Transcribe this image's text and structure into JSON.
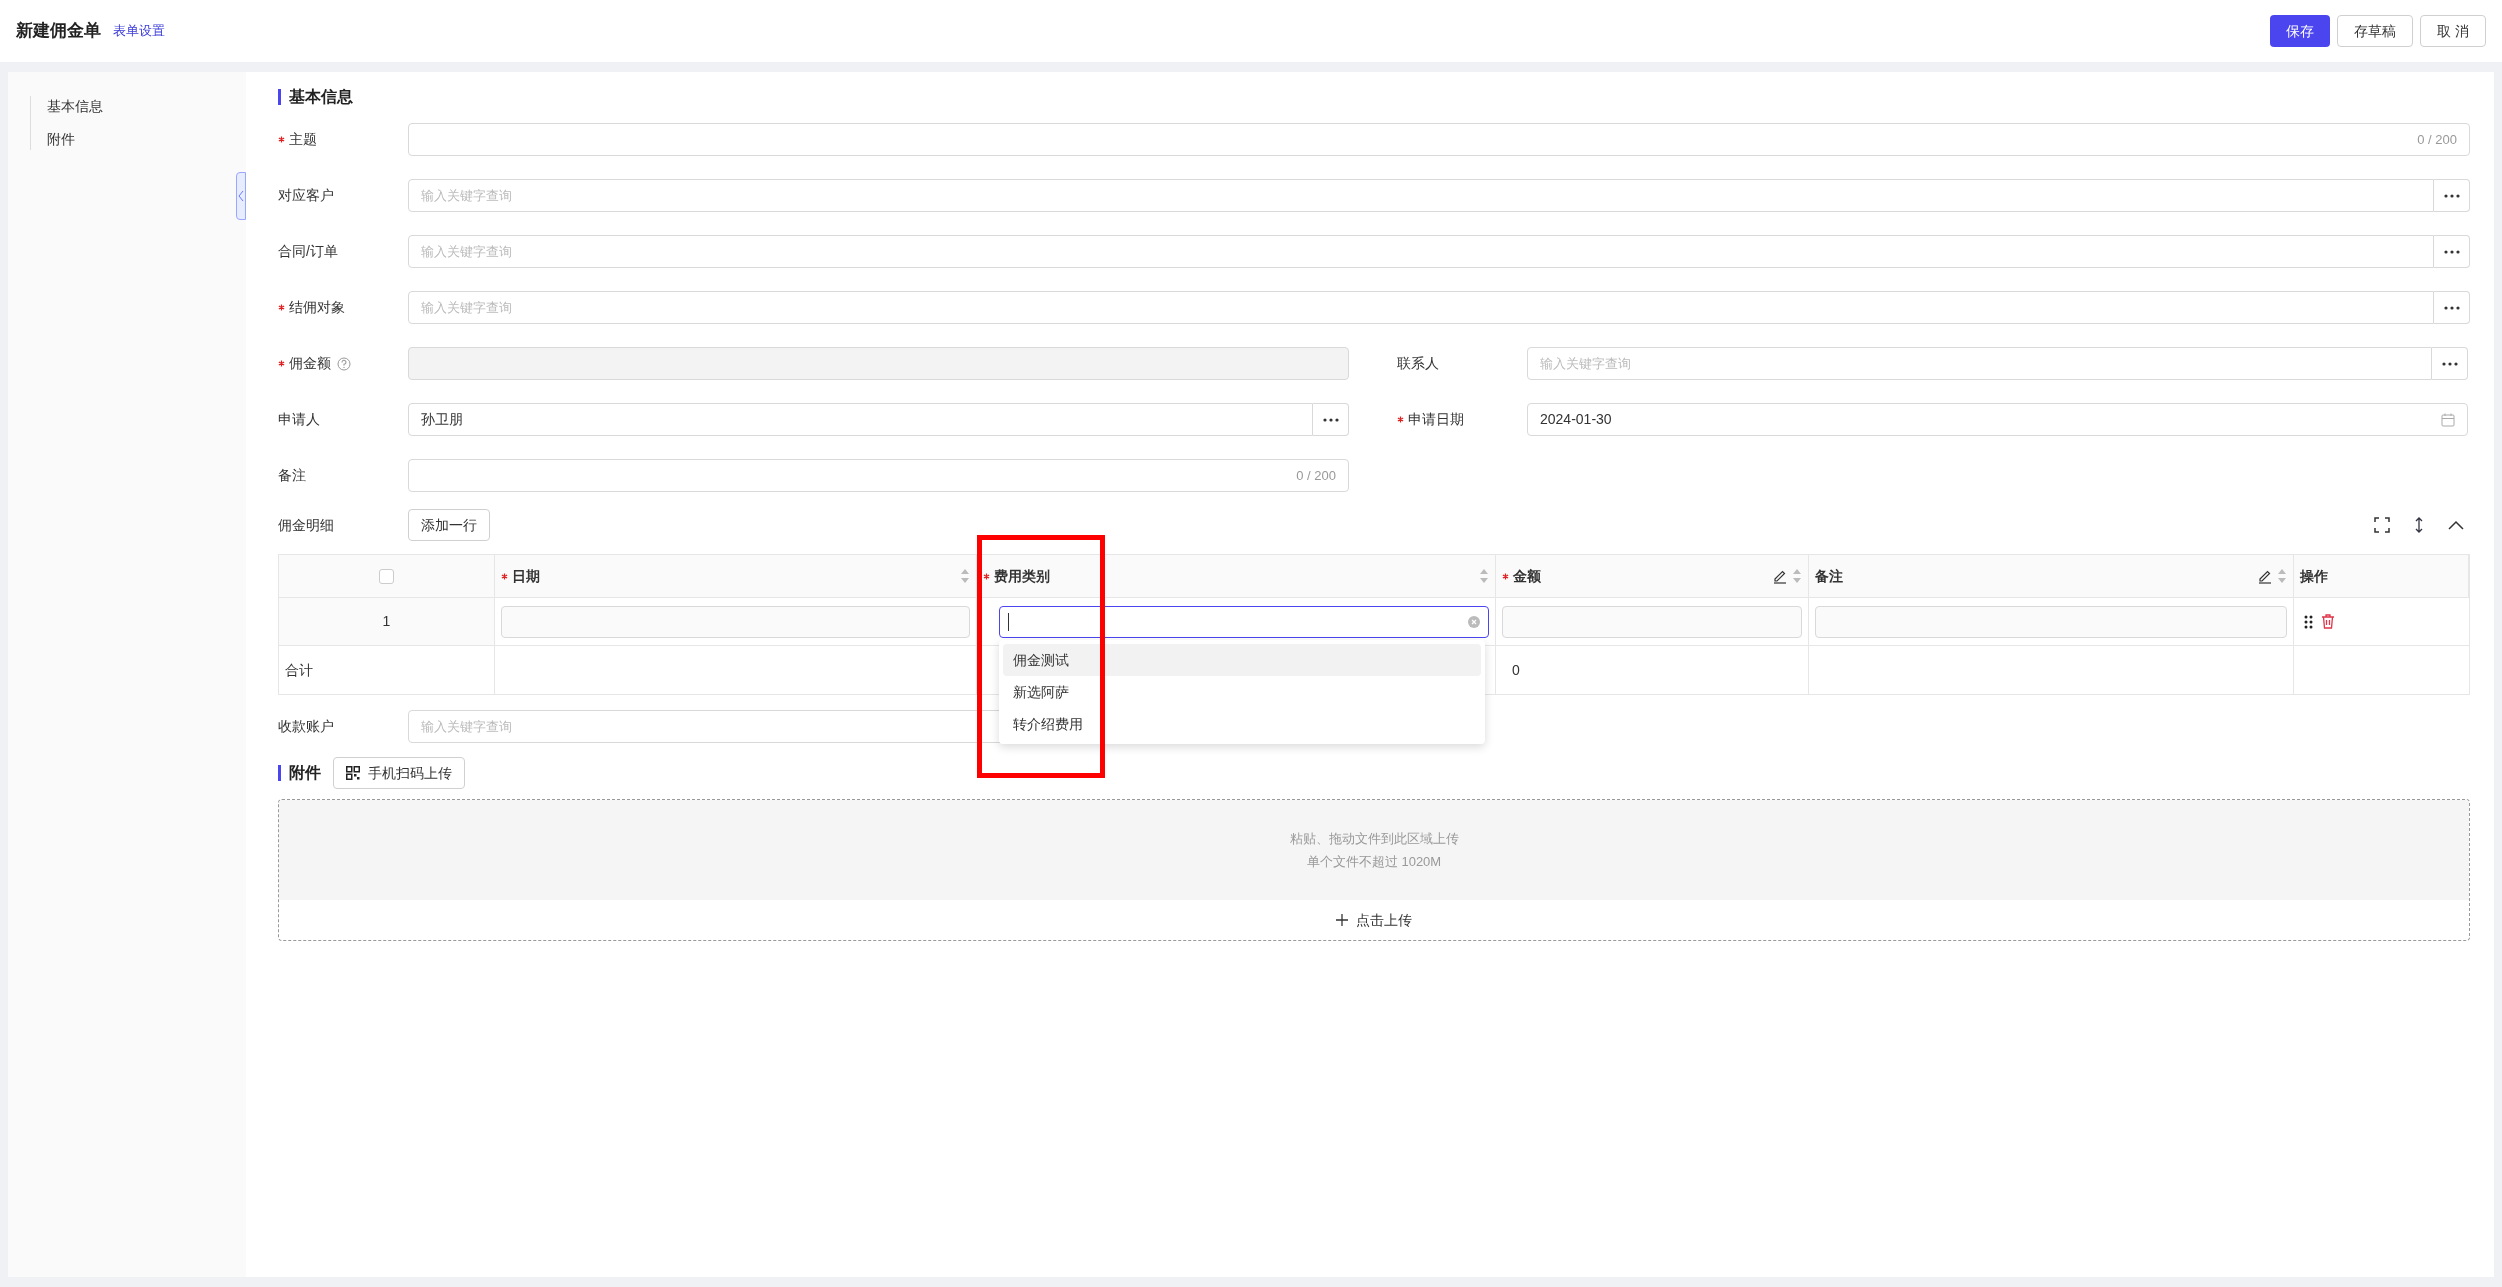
{
  "header": {
    "title": "新建佣金单",
    "link": "表单设置",
    "buttons": [
      {
        "label": "保存",
        "kind": "primary"
      },
      {
        "label": "存草稿",
        "kind": "default"
      },
      {
        "label": "取 消",
        "kind": "default"
      }
    ]
  },
  "sidebar": {
    "items": [
      {
        "label": "基本信息"
      },
      {
        "label": "附件"
      }
    ]
  },
  "basic": {
    "title": "基本信息",
    "rows": [
      {
        "kind": "wide",
        "fields": [
          {
            "label": "主题",
            "required": true,
            "kind": "text",
            "counter": "0 / 200"
          }
        ]
      },
      {
        "kind": "wide",
        "fields": [
          {
            "label": "对应客户",
            "required": false,
            "kind": "lookup",
            "placeholder": "输入关键字查询"
          }
        ]
      },
      {
        "kind": "wide",
        "fields": [
          {
            "label": "合同/订单",
            "required": false,
            "kind": "lookup",
            "placeholder": "输入关键字查询"
          }
        ]
      },
      {
        "kind": "wide",
        "fields": [
          {
            "label": "结佣对象",
            "required": true,
            "kind": "lookup",
            "placeholder": "输入关键字查询"
          }
        ]
      },
      {
        "kind": "split",
        "fields": [
          {
            "label": "佣金额",
            "required": true,
            "kind": "readonly",
            "help": true
          },
          {
            "label": "联系人",
            "required": false,
            "kind": "lookup",
            "placeholder": "输入关键字查询"
          }
        ]
      },
      {
        "kind": "split",
        "fields": [
          {
            "label": "申请人",
            "required": false,
            "kind": "lookup",
            "value": "孙卫朋"
          },
          {
            "label": "申请日期",
            "required": true,
            "kind": "date",
            "value": "2024-01-30"
          }
        ]
      },
      {
        "kind": "split",
        "fields": [
          {
            "label": "备注",
            "required": false,
            "kind": "text",
            "counter": "0 / 200"
          }
        ]
      }
    ]
  },
  "detail": {
    "label": "佣金明细",
    "add_button": "添加一行",
    "header_checkbox": {
      "checked": false
    },
    "columns": [
      {
        "label": "日期",
        "required": true,
        "sortable": true,
        "editable": false
      },
      {
        "label": "费用类别",
        "required": true,
        "sortable": true,
        "editable": false
      },
      {
        "label": "金额",
        "required": true,
        "sortable": true,
        "editable": true
      },
      {
        "label": "备注",
        "required": false,
        "sortable": true,
        "editable": true
      },
      {
        "label": "操作",
        "required": false,
        "sortable": false,
        "editable": false
      }
    ],
    "rows": [
      {
        "index": "1",
        "cells": [
          {
            "kind": "input"
          },
          {
            "kind": "select"
          },
          {
            "kind": "input"
          },
          {
            "kind": "input"
          }
        ]
      }
    ],
    "total": {
      "label": "合计",
      "amount": "0"
    },
    "dropdown": {
      "open": true,
      "options": [
        {
          "label": "佣金测试",
          "selected": true
        },
        {
          "label": "新选阿萨",
          "selected": false
        },
        {
          "label": "转介绍费用",
          "selected": false
        }
      ]
    }
  },
  "account": {
    "label": "收款账户",
    "placeholder": "输入关键字查询"
  },
  "attachments": {
    "title": "附件",
    "scan_button": "手机扫码上传",
    "hints": [
      "粘贴、拖动文件到此区域上传",
      "单个文件不超过 1020M"
    ],
    "upload": "点击上传"
  }
}
